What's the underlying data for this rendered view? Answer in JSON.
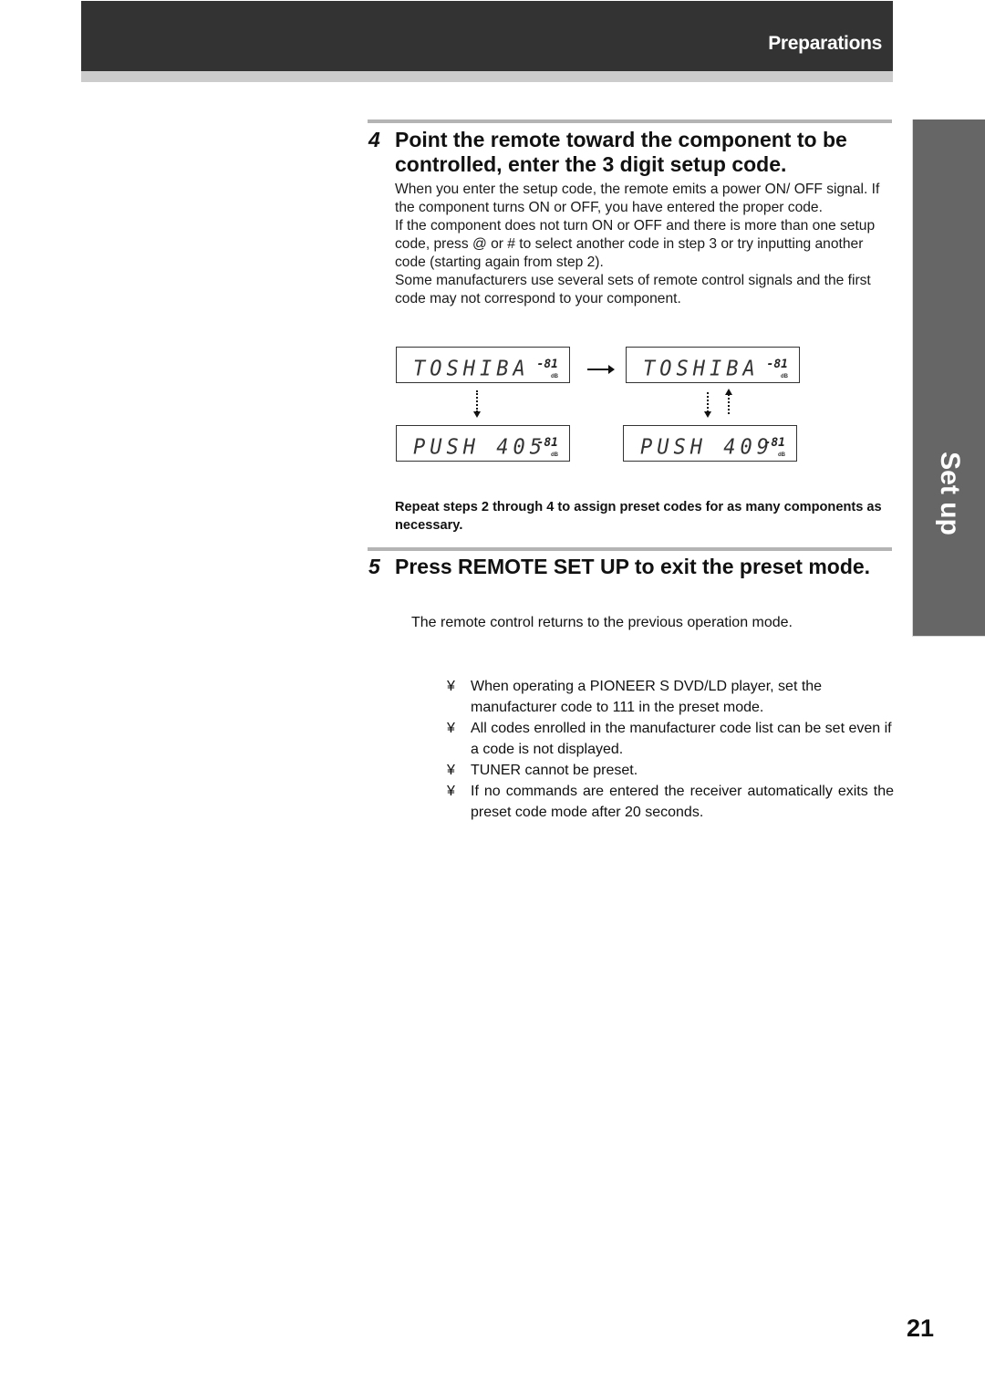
{
  "header": {
    "section_title": "Preparations"
  },
  "side_tab": {
    "label": "Set up"
  },
  "step4": {
    "number": "4",
    "title": "Point the remote toward the component to be controlled, enter the 3 digit setup code.",
    "paragraphs": [
      "When you enter the setup code, the remote emits a power ON/ OFF signal. If the component turns ON or OFF, you have entered the proper code.",
      "If the component does not turn ON or OFF and there is more than one setup code, press @ or #  to select another code in step 3 or try inputting another code (starting again from step 2).",
      "Some manufacturers use several sets of remote control signals and the first code may not correspond to your component."
    ],
    "displays": [
      {
        "text": "TOSHIBA",
        "level": "-81",
        "unit": "dB"
      },
      {
        "text": "TOSHIBA",
        "level": "-81",
        "unit": "dB"
      },
      {
        "text": "PUSH 405",
        "level": "-81",
        "unit": "dB"
      },
      {
        "text": "PUSH 409",
        "level": "-81",
        "unit": "dB"
      }
    ]
  },
  "repeat_note": "Repeat steps 2 through 4 to assign preset codes for as many components as necessary.",
  "step5": {
    "number": "5",
    "title": "Press REMOTE SET UP to exit the preset mode.",
    "body": "The remote control returns to the previous operation mode."
  },
  "notes": {
    "bullet": "¥",
    "items": [
      "When operating a PIONEER S DVD/LD player, set the manufacturer code to  111  in the preset mode.",
      "All codes enrolled in the manufacturer code list can be set even if a code is not displayed.",
      "TUNER cannot be preset.",
      "If no commands are entered the receiver automatically exits the preset code mode after 20 seconds."
    ]
  },
  "page_number": "21"
}
